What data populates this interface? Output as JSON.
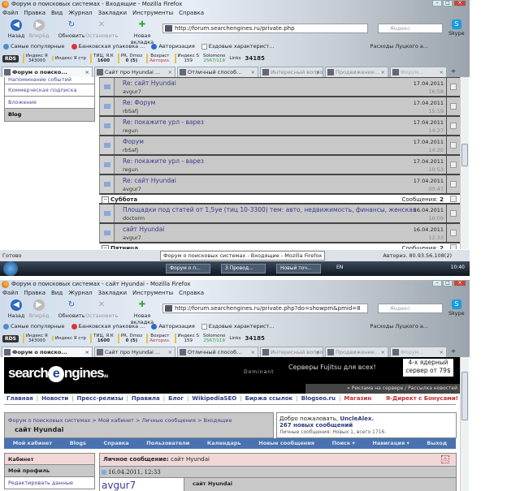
{
  "window1": {
    "title": "Форум о поисковых системах - Входящие - Mozilla Firefox",
    "menu": [
      "Файл",
      "Правка",
      "Вид",
      "Журнал",
      "Закладки",
      "Инструменты",
      "Справка"
    ],
    "nav": {
      "back": "Назад",
      "forward": "Вперёд",
      "reload": "Обновить",
      "stop": "Остановить",
      "new_tab": "Новая вкладка"
    },
    "url": "http://forum.searchengines.ru/private.php",
    "search_placeholder": "Яндекс",
    "skype": "Skype",
    "bookmarks": [
      "Самые популярные",
      "Банковская упаковка ...",
      "Авторизация",
      "Ездовые характерист...",
      "Расходы Луцкого а..."
    ],
    "addons": {
      "rds": "RDS",
      "yandex_index": "Индекс Я",
      "yandex_index_val": "343000",
      "yandex_str": "Индекс Я стр",
      "tic_label": "ТИЦ, Я.К",
      "tic": "1600",
      "pr_label": "PR, Dmoz",
      "pr": "0 (5)",
      "age_label": "Возраст",
      "age": "Авториз.",
      "index_s": "Индекс S",
      "index_s_val": "159",
      "solomono": "Solomono",
      "solomono_val": "2567/119",
      "links": "Links",
      "counter": "34185"
    },
    "tabs": [
      "Форум о поиско...",
      "Сайт про Hyundai ...",
      "Отличный способ...",
      "Интересный вопрос А...",
      "Продвижение...",
      "Форум..."
    ],
    "sidebar": [
      "Напоминание событий",
      "Коммерческая подписка",
      "Вложения",
      "Blog"
    ],
    "rows": [
      {
        "title": "Re: сайт Hyundai",
        "author": "avgur7",
        "date": "17.04.2011",
        "time": "16:58"
      },
      {
        "title": "Re: Форум",
        "author": "rbSafj",
        "date": "17.04.2011",
        "time": "15:19"
      },
      {
        "title": "Re: покажите урл - варез",
        "author": "regun",
        "date": "17.04.2011",
        "time": "14:27"
      },
      {
        "title": "Форум",
        "author": "rbSafj",
        "date": "17.04.2011",
        "time": "14:20"
      },
      {
        "title": "Re: покажите урл - варез",
        "author": "regun",
        "date": "17.04.2011",
        "time": "10:53"
      },
      {
        "title": "Re: сайт Hyundai",
        "author": "avgur7",
        "date": "17.04.2011",
        "time": "00:47"
      }
    ],
    "group_sat": {
      "label": "Суббота",
      "count_label": "Сообщения:",
      "count": "2"
    },
    "rows_sat": [
      {
        "title": "Площадки под статей от 1,5уе (тиц 10-3300) тем: авто, недвижимость, финансы, женская",
        "author": "doctorm",
        "date": "16.04.2011",
        "time": "16:09"
      },
      {
        "title": "сайт Hyundai",
        "author": "avgur7",
        "date": "16.04.2011",
        "time": "12:33"
      }
    ],
    "group_fri": {
      "label": "Пятница",
      "count_label": "Сообщения:",
      "count": "2"
    },
    "status": "Готово",
    "tooltip": "Форум о поисковых системах - Входящие - Mozilla Firefox",
    "status_right": "Авториз.     80.93.56.108(2)",
    "taskbar": [
      "Форум о п...",
      "3 Провод...",
      "Новый точ..."
    ],
    "lang": "EN",
    "clock": "10:40"
  },
  "window2": {
    "title": "Форум о поисковых системах - сайт Hyundai - Mozilla Firefox",
    "url": "http://forum.searchengines.ru/private.php?do=showpm&pmid=8",
    "banner": {
      "logo_a": "search",
      "logo_e": "e",
      "logo_b": "ngines",
      "logo_ru": ".ru",
      "ad_text": "Серверы Fujitsu для всех!",
      "brand": "Dominant",
      "ad_right": "4-х ядерный сервер от 79$",
      "ad_links": "» Реклама на сервере / Рассылка новостей"
    },
    "toplinks": [
      "Главная",
      "Новости",
      "Пресс-релизы",
      "Правила",
      "Блог",
      "WikipediaSEO",
      "Биржа ссылок",
      "Blogseo.ru"
    ],
    "shop": "Магазин",
    "direct": "Я-Директ с Бонусами!",
    "breadcrumb": "Форум о поисковых системах > Мой кабинет > Личные сообщения > Входящие",
    "current": "сайт Hyundai",
    "welcome": {
      "hello": "Добро пожаловать,",
      "user": "UncleAlex.",
      "new_msgs": "267 новых сообщений",
      "pm": "Личные сообщения: Новых 1, всего 1716."
    },
    "bluenav": [
      "Мой кабинет",
      "Blogs",
      "Справка",
      "Пользователи",
      "Календарь",
      "Новые сообщения",
      "Поиск ▾",
      "Навигация ▾",
      "Выход"
    ],
    "cabinet": [
      "Кабинет",
      "Мой профиль",
      "Редактировать данные"
    ],
    "message": {
      "header_label": "Личное сообщение:",
      "header_title": "сайт Hyundai",
      "date": "16.04.2011, 12:33",
      "author": "avgur7",
      "subject": "сайт Hyundai"
    }
  }
}
